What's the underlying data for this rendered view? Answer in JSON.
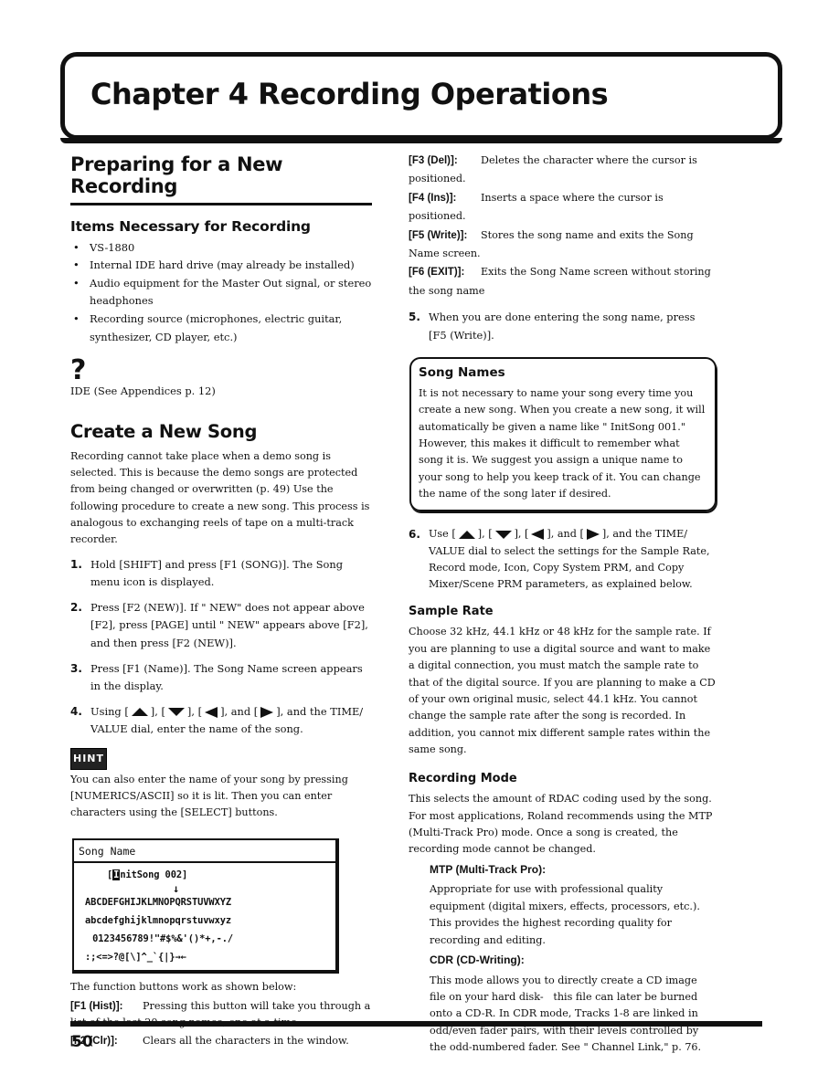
{
  "chapter": {
    "title": "Chapter 4 Recording Operations"
  },
  "left": {
    "section_title_line1": "Preparing for a New",
    "section_title_line2": "Recording",
    "items_heading": "Items Necessary for Recording",
    "items": [
      "VS-1880",
      "Internal IDE hard drive (may already be installed)",
      "Audio equipment for the Master Out signal, or stereo headphones",
      "Recording source (microphones, electric guitar, synthesizer, CD player, etc.)"
    ],
    "bullet_glyph": "•",
    "question_icon": "?",
    "ide_ref": "IDE (See Appendices p. 12)",
    "create_heading": "Create a New Song",
    "create_intro": "Recording cannot take place when a demo song is selected. This is because the demo songs are protected from being changed or overwritten (p. 49) Use the following procedure to create a new song. This process is analogous to exchanging reels of tape on a multi-track recorder.",
    "steps": [
      {
        "num": "1.",
        "text": "Hold [SHIFT] and press [F1 (SONG)]. The Song menu icon is displayed."
      },
      {
        "num": "2.",
        "text": "Press [F2 (NEW)]. If \" NEW\" does not appear above [F2], press [PAGE] until \" NEW\" appears above [F2], and then press [F2 (NEW)]."
      },
      {
        "num": "3.",
        "text": "Press [F1 (Name)]. The Song Name screen appears in the display."
      },
      {
        "num": "4.",
        "prefix": "Using [",
        "sep1": "], [",
        "sep2": "], [",
        "sep3": "], and [",
        "suffix": "], and the TIME/ VALUE dial, enter the name of the song."
      }
    ],
    "hint_icon": "HINT",
    "hint_text": "You can also enter the name of your song by pressing [NUMERICS/ASCII] so it is lit. Then you can enter characters using the [SELECT] buttons.",
    "lcd": {
      "title": "Song Name",
      "bracket_open": "[",
      "cursor_char": "I",
      "name_rest": "nitSong 002]",
      "arrow": "↓",
      "rows": [
        "ABCDEFGHIJKLMNOPQRSTUVWXYZ",
        "abcdefghijklmnopqrstuvwxyz",
        " 0123456789!\"#$%&'()*+,-./",
        ":;<=>?@[\\]^_`{|}→←"
      ]
    },
    "fn_intro": "The function buttons work as shown below:",
    "fn_buttons": [
      {
        "key": "[F1 (Hist)]:",
        "desc": "Pressing this button will take you through a list of the last 20 song names, one at a time."
      },
      {
        "key": "[F2 (Clr)]:",
        "desc": "Clears all the characters in the window."
      }
    ]
  },
  "right": {
    "fn_buttons": [
      {
        "key": "[F3 (Del)]:",
        "desc": "Deletes the character where the cursor is positioned."
      },
      {
        "key": "[F4 (Ins)]:",
        "desc": "Inserts a space where the cursor is positioned."
      },
      {
        "key": "[F5 (Write)]:",
        "desc": "Stores the song name and exits the Song Name screen."
      },
      {
        "key": "[F6 (EXIT)]:",
        "desc": "Exits the Song Name screen without storing the song name"
      }
    ],
    "step5": {
      "num": "5.",
      "text": "When you are done entering the song name, press [F5 (Write)]."
    },
    "tip": {
      "title": "Song Names",
      "text": "It is not necessary to name your song every time you create a new song. When you create a new song, it will automatically be given a name like \" InitSong 001.\" However, this makes it difficult to remember what song it is. We suggest you assign a unique name to your song to help you keep track of it. You can change the name of the song later if desired."
    },
    "step6": {
      "num": "6.",
      "prefix": "Use [",
      "sep1": "], [",
      "sep2": "], [",
      "sep3": "], and [",
      "suffix": "], and the TIME/ VALUE dial to select the settings for the Sample Rate, Record mode, Icon, Copy System PRM, and Copy Mixer/Scene PRM parameters, as explained below."
    },
    "sample_rate": {
      "heading": "Sample Rate",
      "text": "Choose 32 kHz, 44.1 kHz or 48 kHz for the sample rate. If you are planning to use a digital source and want to make a digital connection, you must match the sample rate to that of the digital source. If you are planning to make a CD of your own original music, select 44.1 kHz. You cannot change the sample rate after the song is recorded. In addition, you cannot mix different sample rates within the same song."
    },
    "recording_mode": {
      "heading": "Recording Mode",
      "text": "This selects the amount of RDAC coding used by the song. For most applications, Roland recommends using the MTP (Multi-Track Pro) mode. Once a song is created, the recording mode cannot be changed.",
      "modes": [
        {
          "name": "MTP (Multi-Track Pro):",
          "desc": "Appropriate for use with professional quality equipment (digital mixers, effects, processors, etc.). This provides the highest recording quality for recording and editing."
        },
        {
          "name": "CDR (CD-Writing):",
          "desc": "This mode allows you to directly create a CD image file on your hard disk-   this file can later be burned onto a CD-R. In CDR mode, Tracks 1-8 are linked in odd/even fader pairs, with their levels controlled by the odd-numbered fader. See \" Channel Link,\" p. 76."
        }
      ]
    }
  },
  "footer": {
    "page_number": "50"
  }
}
